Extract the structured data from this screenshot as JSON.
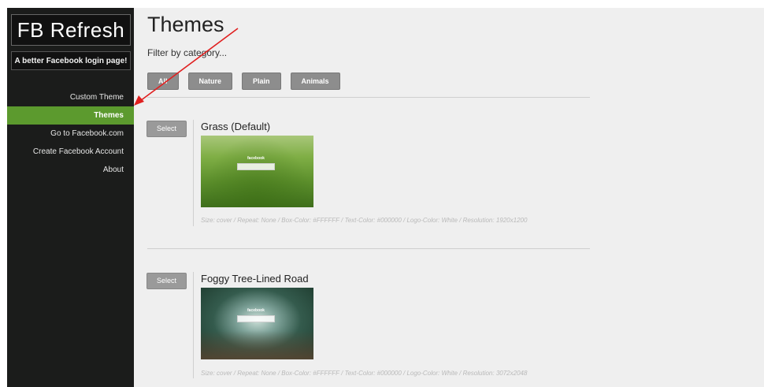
{
  "sidebar": {
    "brand_title": "FB Refresh",
    "tagline": "A better Facebook login page!",
    "nav": [
      {
        "label": "Custom Theme"
      },
      {
        "label": "Themes"
      },
      {
        "label": "Go to Facebook.com"
      },
      {
        "label": "Create Facebook Account"
      },
      {
        "label": "About"
      }
    ],
    "active_index": 1
  },
  "main": {
    "title": "Themes",
    "filter_label": "Filter by category...",
    "filters": [
      {
        "label": "All"
      },
      {
        "label": "Nature"
      },
      {
        "label": "Plain"
      },
      {
        "label": "Animals"
      }
    ]
  },
  "themes": [
    {
      "select_label": "Select",
      "name": "Grass (Default)",
      "preview_logo": "facebook",
      "meta": "Size: cover / Repeat: None / Box-Color: #FFFFFF / Text-Color: #000000 / Logo-Color: White / Resolution: 1920x1200"
    },
    {
      "select_label": "Select",
      "name": "Foggy Tree-Lined Road",
      "preview_logo": "facebook",
      "meta": "Size: cover / Repeat: None / Box-Color: #FFFFFF / Text-Color: #000000 / Logo-Color: White / Resolution: 3072x2048"
    }
  ],
  "colors": {
    "sidebar_bg": "#1b1c1b",
    "active_nav": "#5c9a2e",
    "main_bg": "#efefef",
    "annotation_arrow": "#e02020"
  }
}
